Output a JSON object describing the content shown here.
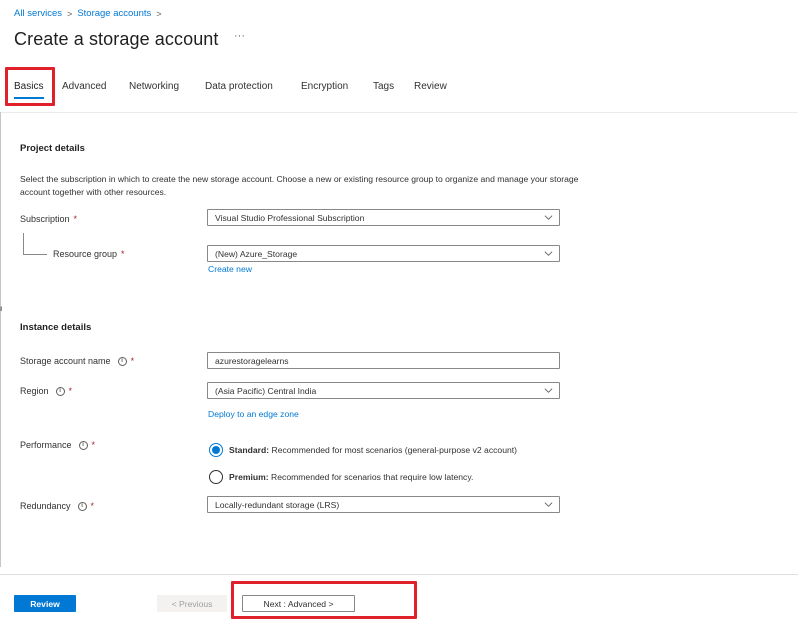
{
  "breadcrumb": {
    "items": [
      "All services",
      "Storage accounts"
    ],
    "separator": ">"
  },
  "page": {
    "title": "Create a storage account",
    "more_label": "···"
  },
  "tabs": [
    {
      "label": "Basics",
      "active": true
    },
    {
      "label": "Advanced"
    },
    {
      "label": "Networking"
    },
    {
      "label": "Data protection"
    },
    {
      "label": "Encryption"
    },
    {
      "label": "Tags"
    },
    {
      "label": "Review"
    }
  ],
  "project": {
    "title": "Project details",
    "description": "Select the subscription in which to create the new storage account. Choose a new or existing resource group to organize and manage your storage account together with other resources.",
    "subscription_label": "Subscription",
    "subscription_value": "Visual Studio Professional Subscription",
    "resource_group_label": "Resource group",
    "resource_group_value": "(New) Azure_Storage",
    "create_new": "Create new"
  },
  "instance": {
    "title": "Instance details",
    "name_label": "Storage account name",
    "name_value": "azurestoragelearns",
    "region_label": "Region",
    "region_value": "(Asia Pacific) Central India",
    "edge_zone_link": "Deploy to an edge zone",
    "performance_label": "Performance",
    "performance_options": [
      {
        "title": "Standard:",
        "desc": "Recommended for most scenarios (general-purpose v2 account)",
        "selected": true
      },
      {
        "title": "Premium:",
        "desc": "Recommended for scenarios that require low latency.",
        "selected": false
      }
    ],
    "redundancy_label": "Redundancy",
    "redundancy_value": "Locally-redundant storage (LRS)"
  },
  "required_mark": "*",
  "info_glyph": "i",
  "footer": {
    "review": "Review",
    "previous": "< Previous",
    "next": "Next : Advanced >"
  },
  "colors": {
    "accent": "#0078d4",
    "highlight": "#e0212b",
    "required": "#a4262c"
  }
}
